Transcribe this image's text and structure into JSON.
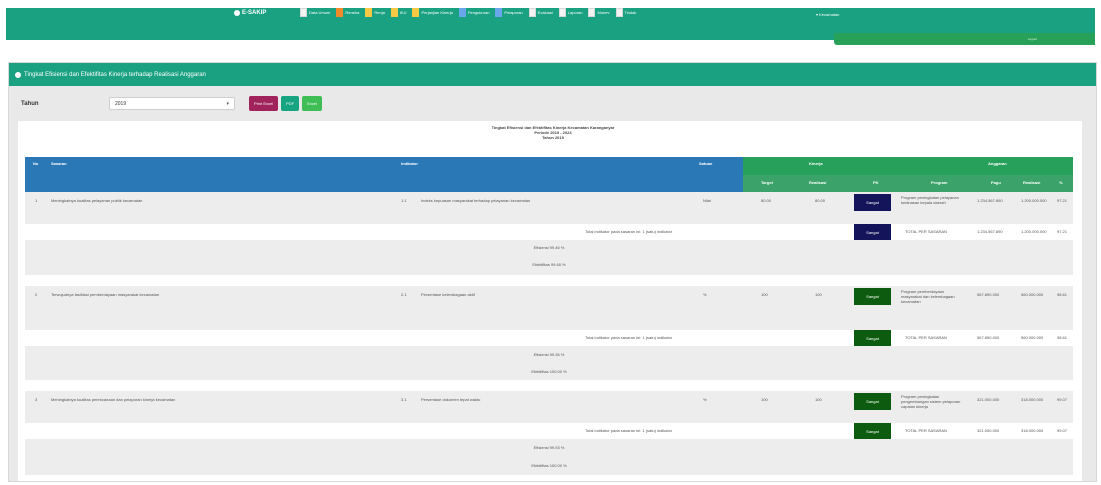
{
  "nav": {
    "brand": "E-SAKIP",
    "menu": [
      {
        "label": "Data Umum",
        "icon": "doc-icon",
        "color": ""
      },
      {
        "label": "Renstra",
        "icon": "doc-icon",
        "color": "orange"
      },
      {
        "label": "Renja",
        "icon": "doc-icon",
        "color": "yellow"
      },
      {
        "label": "IKU",
        "icon": "doc-icon",
        "color": "yellow"
      },
      {
        "label": "Perjanjian Kinerja",
        "icon": "doc-icon",
        "color": "yellow"
      },
      {
        "label": "Pengukuran",
        "icon": "doc-icon",
        "color": "blue"
      },
      {
        "label": "Pelaporan",
        "icon": "doc-icon",
        "color": "blue"
      },
      {
        "label": "Evaluasi",
        "icon": "doc-icon",
        "color": ""
      },
      {
        "label": "Laporan",
        "icon": "doc-icon",
        "color": ""
      },
      {
        "label": "Monev",
        "icon": "doc-icon",
        "color": ""
      },
      {
        "label": "Tindak",
        "icon": "doc-icon",
        "color": ""
      }
    ],
    "user": "Kecamatan",
    "subbar_text": "Logout"
  },
  "panel": {
    "title": "Tingkat Efisiensi dan Efektifitas Kinerja terhadap Realisasi Anggaran",
    "filter_label": "Tahun",
    "select_value": "2019",
    "buttons": {
      "print": "Print Excel",
      "pdf": "PDF",
      "excel": "Excel"
    }
  },
  "report": {
    "title_lines": [
      "Tingkat Efisiensi dan Efektifitas Kinerja Kecamatan Karanganyar",
      "Periode 2019 - 2024",
      "Tahun 2019"
    ],
    "headers": {
      "no": "No",
      "sasaran": "Sasaran",
      "indikator": "Indikator",
      "satuan": "Satuan",
      "kinerja": "Kinerja",
      "anggaran": "Anggaran",
      "sub_kinerja": [
        "Target",
        "Realisasi",
        "PK"
      ],
      "sub_anggaran": [
        "Program",
        "Pagu",
        "Realisasi",
        "%"
      ]
    },
    "rows": [
      {
        "no": "1",
        "sasaran": "Meningkatnya kualitas pelayanan publik kecamatan",
        "ind_no": "1.1",
        "indikator": "Indeks kepuasan masyarakat terhadap pelayanan kecamatan",
        "satuan": "Nilai",
        "target": "80.00",
        "realisasi": "80.00",
        "pk": "Sangat",
        "program": "Program peningkatan pelayanan kedinasan kepala daerah",
        "pagu": "1.234.567.890",
        "real": "1.200.000.000",
        "pct": "97.21",
        "sub_label": "Total indikator pada sasaran ini: 1 (satu) indikator",
        "sub_badge": "Sangat",
        "sub_program": "TOTAL PER SASARAN",
        "sub_pagu": "1.234.567.890",
        "sub_real": "1.200.000.000",
        "sub_pct": "97.21",
        "efisiensi": "Efisiensi 99.46 %",
        "efektifitas": "Efektifitas 99.48 %"
      },
      {
        "no": "2",
        "sasaran": "Terwujudnya fasilitasi pemberdayaan masyarakat kecamatan",
        "ind_no": "2.1",
        "indikator": "Persentase kelembagaan aktif",
        "satuan": "%",
        "target": "100",
        "realisasi": "100",
        "pk": "Sangat",
        "program": "Program pemberdayaan masyarakat dan kelembagaan kecamatan",
        "pagu": "567.890.000",
        "real": "560.000.000",
        "pct": "98.61",
        "sub_label": "Total indikator pada sasaran ini: 1 (satu) indikator",
        "sub_badge": "Sangat",
        "sub_program": "TOTAL PER SASARAN",
        "sub_pagu": "567.890.000",
        "sub_real": "560.000.000",
        "sub_pct": "98.61",
        "efisiensi": "Efisiensi 99.36 %",
        "efektifitas": "Efektifitas 100.00 %"
      },
      {
        "no": "3",
        "sasaran": "Meningkatnya kualitas perencanaan dan pelaporan kinerja kecamatan",
        "ind_no": "3.1",
        "indikator": "Persentase dokumen tepat waktu",
        "satuan": "%",
        "target": "100",
        "realisasi": "100",
        "pk": "Sangat",
        "program": "Program peningkatan pengembangan sistem pelaporan capaian kinerja",
        "pagu": "321.000.000",
        "real": "318.000.000",
        "pct": "99.07",
        "sub_label": "Total indikator pada sasaran ini: 1 (satu) indikator",
        "sub_badge": "Sangat",
        "sub_program": "TOTAL PER SASARAN",
        "sub_pagu": "321.000.000",
        "sub_real": "318.000.000",
        "sub_pct": "99.07",
        "efisiensi": "Efisiensi 99.93 %",
        "efektifitas": "Efektifitas 100.00 %"
      }
    ]
  }
}
